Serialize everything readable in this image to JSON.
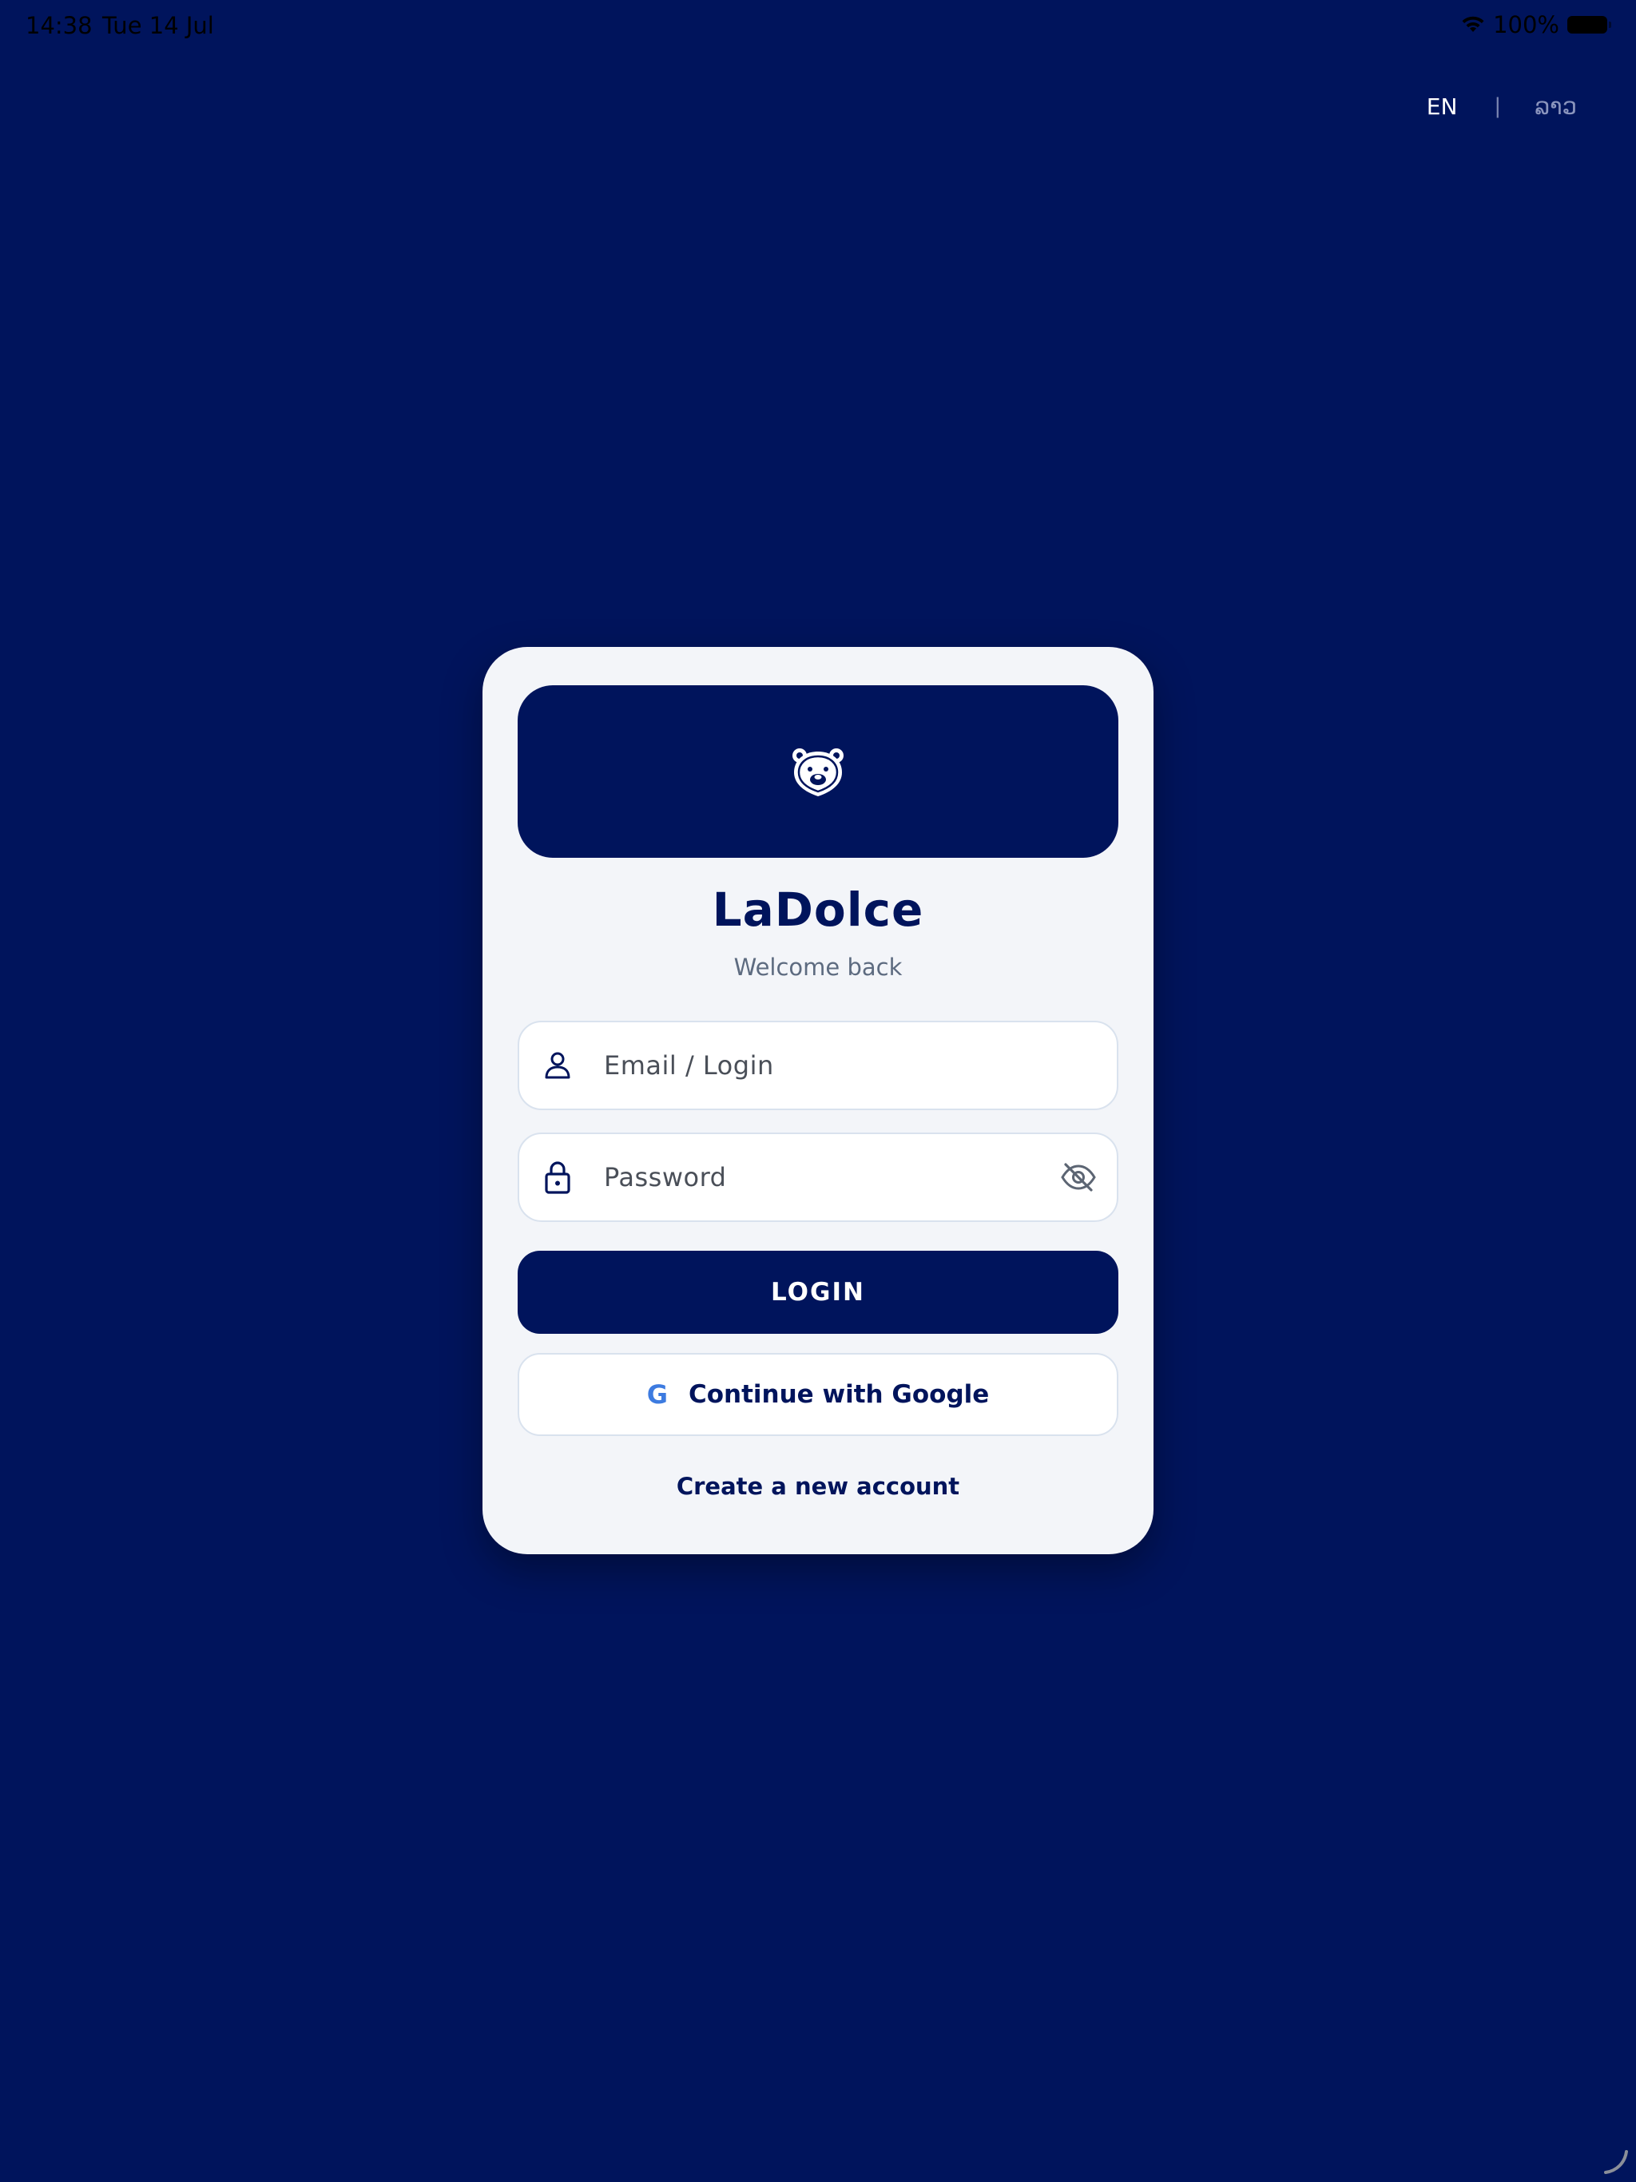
{
  "status_bar": {
    "time": "14:38",
    "date": "Tue 14 Jul",
    "battery": "100%"
  },
  "language": {
    "active": "EN",
    "separator": "|",
    "alternate": "ລາວ"
  },
  "app": {
    "title": "LaDolce",
    "subtitle": "Welcome back"
  },
  "form": {
    "email_placeholder": "Email / Login",
    "email_value": "",
    "password_placeholder": "Password",
    "password_value": "",
    "login_label": "LOGIN",
    "google_letter": "G",
    "google_label": "Continue with Google",
    "create_account_label": "Create a new account"
  },
  "icons": {
    "logo": "bear-logo-icon",
    "email": "user-icon",
    "password": "lock-icon",
    "toggle": "eye-off-icon",
    "google": "google-icon"
  },
  "colors": {
    "background": "#00145c",
    "card": "#f3f5f9",
    "primary": "#00145c",
    "google_blue": "#3d7be0",
    "muted_text": "#5d6b80"
  }
}
